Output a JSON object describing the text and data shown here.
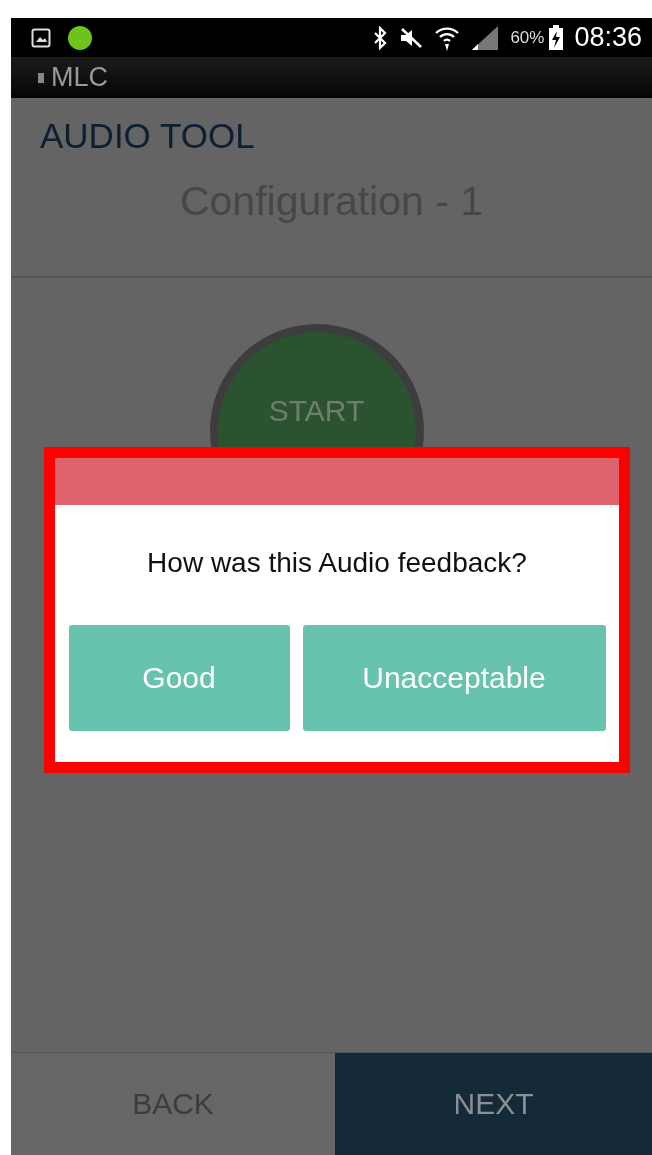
{
  "status_bar": {
    "battery_text": "60%",
    "time": "08:36"
  },
  "app_bar": {
    "title": "MLC"
  },
  "header": {
    "title": "AUDIO TOOL",
    "subtitle": "Configuration - 1"
  },
  "start_button": {
    "label": "START"
  },
  "dialog": {
    "question": "How was this Audio feedback?",
    "buttons": [
      {
        "label": "Good"
      },
      {
        "label": "Unacceptable"
      }
    ]
  },
  "nav": {
    "buttons": [
      {
        "label": "BACK",
        "kind": "secondary"
      },
      {
        "label": "NEXT",
        "kind": "primary"
      }
    ]
  }
}
